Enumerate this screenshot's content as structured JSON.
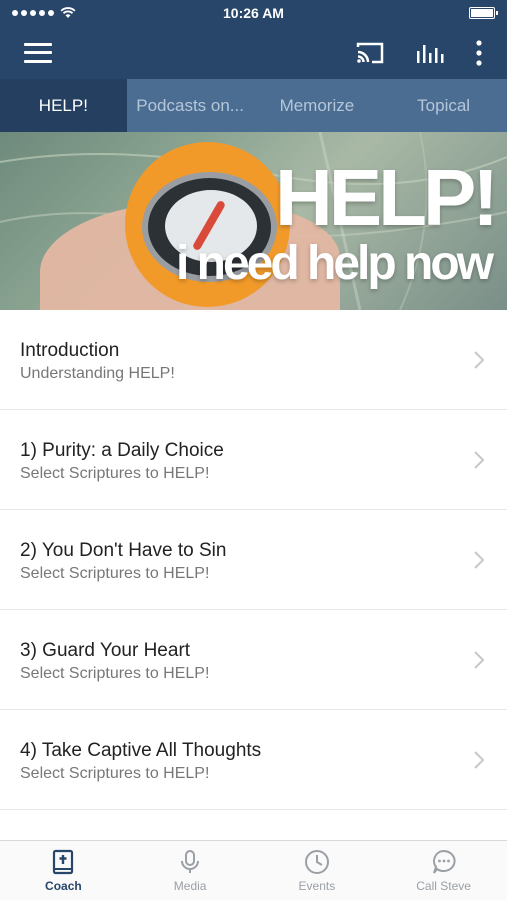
{
  "status_bar": {
    "time": "10:26 AM"
  },
  "app_bar": {
    "icons": [
      "menu-icon",
      "cast-icon",
      "equalizer-icon",
      "more-vertical-icon"
    ]
  },
  "tabs": [
    {
      "label": "HELP!",
      "active": true
    },
    {
      "label": "Podcasts on...",
      "active": false
    },
    {
      "label": "Memorize",
      "active": false
    },
    {
      "label": "Topical",
      "active": false
    }
  ],
  "banner": {
    "title": "HELP!",
    "subtitle": "i need help now"
  },
  "list": [
    {
      "title": "Introduction",
      "subtitle": "Understanding HELP!"
    },
    {
      "title": "1) Purity: a Daily Choice",
      "subtitle": "Select Scriptures to HELP!"
    },
    {
      "title": "2) You Don't Have to Sin",
      "subtitle": "Select Scriptures to HELP!"
    },
    {
      "title": "3) Guard Your Heart",
      "subtitle": "Select Scriptures to HELP!"
    },
    {
      "title": "4) Take Captive All Thoughts",
      "subtitle": "Select Scriptures to HELP!"
    }
  ],
  "bottom_nav": [
    {
      "label": "Coach",
      "icon": "bible-icon",
      "active": true
    },
    {
      "label": "Media",
      "icon": "microphone-icon",
      "active": false
    },
    {
      "label": "Events",
      "icon": "clock-icon",
      "active": false
    },
    {
      "label": "Call Steve",
      "icon": "chat-bubble-icon",
      "active": false
    }
  ],
  "colors": {
    "primary": "#27466a",
    "tab_bar": "#4b6d92",
    "tab_active": "#243f5f"
  }
}
